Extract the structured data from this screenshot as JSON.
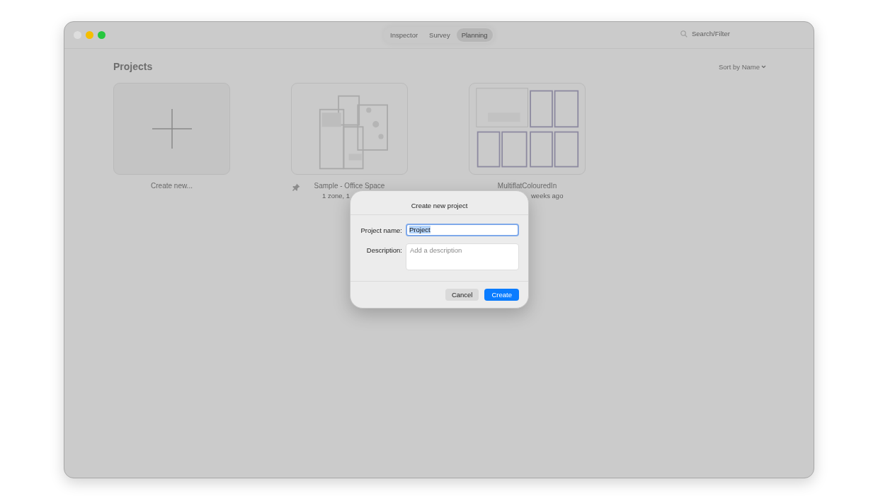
{
  "toolbar": {
    "tabs": [
      {
        "label": "Inspector",
        "selected": false
      },
      {
        "label": "Survey",
        "selected": false
      },
      {
        "label": "Planning",
        "selected": true
      }
    ],
    "search": {
      "placeholder": "Search/Filter"
    }
  },
  "heading": "Projects",
  "sort": "Sort by Name",
  "projects": [
    {
      "kind": "new",
      "name": "Create new..."
    },
    {
      "kind": "project",
      "name": "Sample - Office Space",
      "meta": "1 zone, 1",
      "pinned": true
    },
    {
      "kind": "project",
      "name": "MultiflatColouredIn",
      "meta": "weeks ago",
      "pinned": false
    }
  ],
  "dialog": {
    "title": "Create new project",
    "fields": [
      {
        "kind": "input",
        "label": "Project name:",
        "value": "Project",
        "focused": true
      },
      {
        "kind": "textarea",
        "label": "Description:",
        "placeholder": "Add a description",
        "focused": false
      }
    ],
    "buttons": [
      {
        "label": "Cancel",
        "primary": false
      },
      {
        "label": "Create",
        "primary": true
      }
    ]
  }
}
